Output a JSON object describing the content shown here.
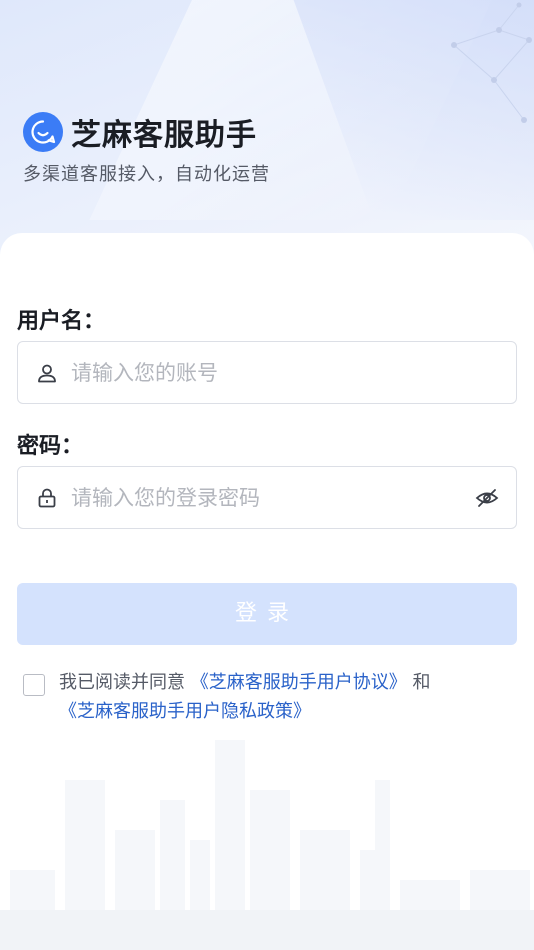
{
  "app": {
    "title": "芝麻客服助手",
    "subtitle": "多渠道客服接入，自动化运营",
    "logo_icon": "smile-chat-icon",
    "brand_color": "#3b7cf6"
  },
  "form": {
    "username_label": "用户名：",
    "username_placeholder": "请输入您的账号",
    "username_value": "",
    "password_label": "密码：",
    "password_placeholder": "请输入您的登录密码",
    "password_value": "",
    "login_button": "登录",
    "login_button_color": "#d4e2fd"
  },
  "agreement": {
    "checked": false,
    "prefix": "我已阅读并同意 ",
    "user_agreement_link": "《芝麻客服助手用户协议》",
    "conjunction": " 和",
    "privacy_link": "《芝麻客服助手用户隐私政策》",
    "link_color": "#2a62c9"
  },
  "icons": {
    "user": "user-icon",
    "lock": "lock-icon",
    "eye": "eye-hidden-icon"
  }
}
